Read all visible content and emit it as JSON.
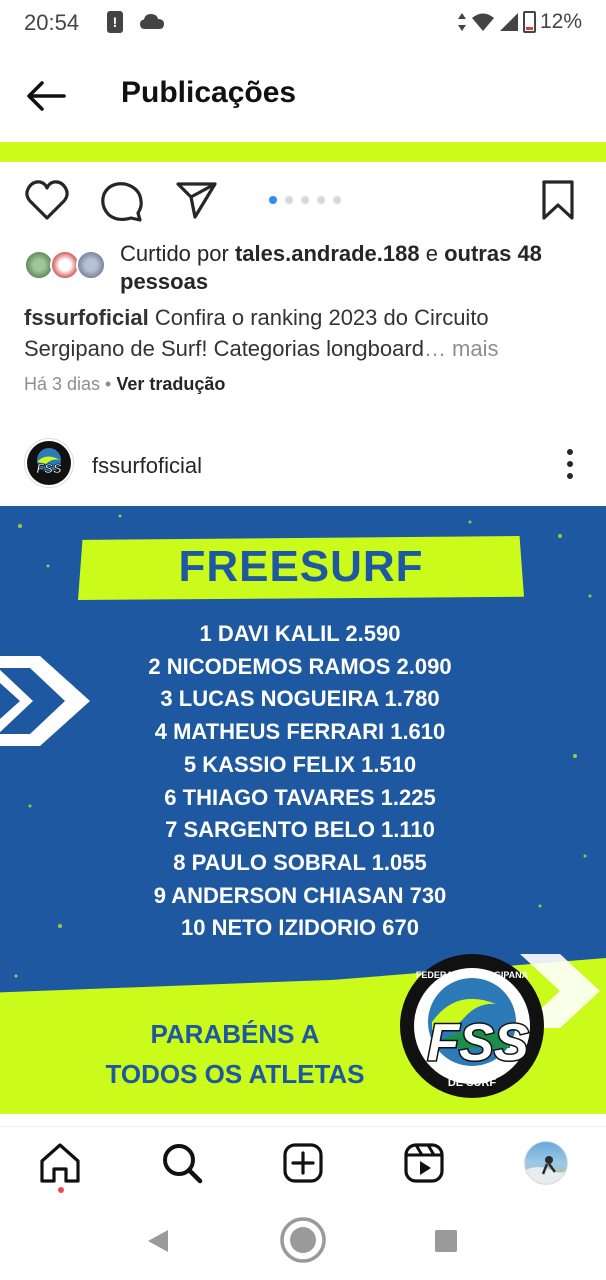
{
  "status_bar": {
    "time": "20:54",
    "alert": "!",
    "battery": "12%"
  },
  "header": {
    "title": "Publicações"
  },
  "actions": {
    "carousel_dots": 5,
    "carousel_active_index": 0
  },
  "likes": {
    "prefix": "Curtido por ",
    "user": "tales.andrade.188",
    "middle": " e ",
    "others": "outras 48 pessoas"
  },
  "caption": {
    "username": "fssurfoficial",
    "text": " Confira o ranking 2023 do Circuito Sergipano de Surf! Categorias longboard",
    "ellipsis": "…",
    "more": " mais"
  },
  "meta": {
    "time": "Há 3 dias",
    "separator": " • ",
    "translate": "Ver tradução"
  },
  "post": {
    "username": "fssurfoficial",
    "image": {
      "title": "FREESURF",
      "ranking": [
        "1 DAVI KALIL 2.590",
        "2 NICODEMOS RAMOS 2.090",
        "3 LUCAS NOGUEIRA 1.780",
        "4 MATHEUS FERRARI 1.610",
        "5 KASSIO FELIX 1.510",
        "6 THIAGO TAVARES 1.225",
        "7 SARGENTO BELO 1.110",
        "8 PAULO SOBRAL 1.055",
        "9 ANDERSON CHIASAN 730",
        "10 NETO IZIDORIO 670"
      ],
      "congrats_line1": "PARABÉNS A",
      "congrats_line2": "TODOS OS ATLETAS",
      "logo_text": "FSS",
      "logo_top": "FEDERAÇÃO SERGIPANA",
      "logo_bottom": "DE SURF"
    }
  },
  "bottom_nav": {
    "items": [
      "home-icon",
      "search-icon",
      "create-icon",
      "reels-icon",
      "profile-avatar"
    ]
  },
  "colors": {
    "lime": "#cbfb1b",
    "blue": "#1e58a0",
    "active_dot": "#2f8bf5",
    "notification": "#ed4956"
  }
}
